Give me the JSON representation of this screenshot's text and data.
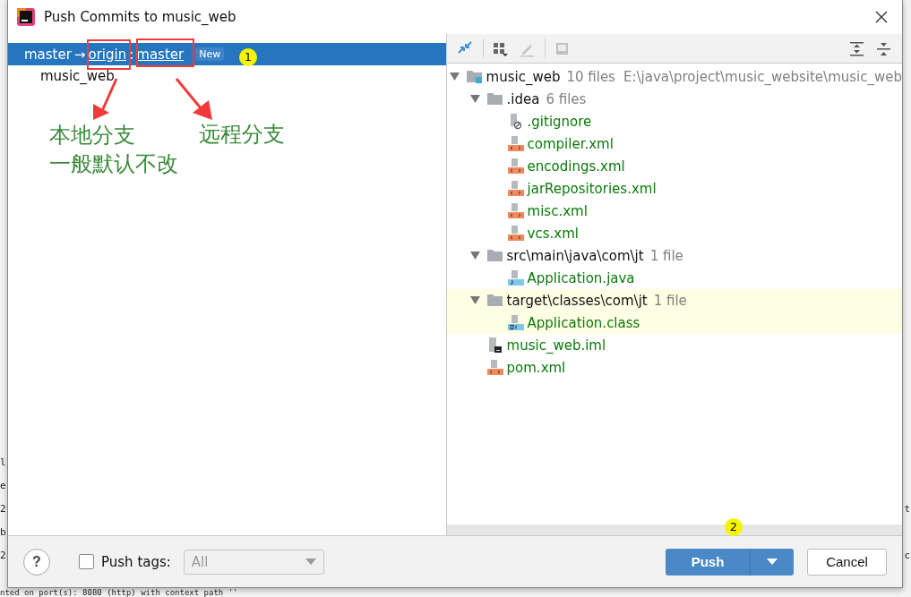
{
  "background": {
    "left_fragments": [
      "l",
      "e",
      "2",
      "b",
      "2"
    ],
    "right_fragments": [
      "t",
      "c"
    ],
    "log_line": "nted on port(s): 8080 (http) with context path ''"
  },
  "window": {
    "title": "Push Commits to music_web"
  },
  "push_spec": {
    "local_branch": "master",
    "arrow": "→",
    "remote": "origin",
    "separator": ":",
    "remote_branch": "master",
    "badge": "New",
    "selected": true
  },
  "repositories": [
    {
      "name": "music_web",
      "selected": false
    }
  ],
  "toolbar": [
    {
      "kind": "diff",
      "disabled": false
    },
    {
      "kind": "group",
      "disabled": false
    },
    {
      "kind": "edit",
      "disabled": true
    },
    {
      "kind": "preview",
      "disabled": true
    },
    {
      "kind": "expand",
      "disabled": false
    },
    {
      "kind": "collapse",
      "disabled": false
    }
  ],
  "tree": [
    {
      "name": "music_web",
      "kind": "module",
      "count": "10 files",
      "path": "E:\\java\\project\\music_website\\music_web",
      "expanded": true,
      "highlighted": false,
      "children": [
        {
          "name": ".idea",
          "kind": "folder",
          "count": "6 files",
          "expanded": true,
          "highlighted": false,
          "children": [
            {
              "name": ".gitignore",
              "kind": "ignored",
              "highlighted": false
            },
            {
              "name": "compiler.xml",
              "kind": "xml",
              "highlighted": false
            },
            {
              "name": "encodings.xml",
              "kind": "xml",
              "highlighted": false
            },
            {
              "name": "jarRepositories.xml",
              "kind": "xml",
              "highlighted": false
            },
            {
              "name": "misc.xml",
              "kind": "xml",
              "highlighted": false
            },
            {
              "name": "vcs.xml",
              "kind": "xml",
              "highlighted": false
            }
          ]
        },
        {
          "name": "src\\main\\java\\com\\jt",
          "kind": "folder",
          "count": "1 file",
          "expanded": true,
          "highlighted": false,
          "children": [
            {
              "name": "Application.java",
              "kind": "java",
              "highlighted": false
            }
          ]
        },
        {
          "name": "target\\classes\\com\\jt",
          "kind": "folder",
          "count": "1 file",
          "expanded": true,
          "highlighted": true,
          "children": [
            {
              "name": "Application.class",
              "kind": "class",
              "highlighted": true
            }
          ]
        },
        {
          "name": "music_web.iml",
          "kind": "iml",
          "highlighted": false
        },
        {
          "name": "pom.xml",
          "kind": "xml",
          "highlighted": false
        }
      ]
    }
  ],
  "footer": {
    "help": "?",
    "push_tags": {
      "label": "Push tags:",
      "checked": false
    },
    "tags_dropdown": {
      "value": "All",
      "disabled": true
    },
    "buttons": [
      {
        "label": "Push",
        "kind": "primary"
      },
      {
        "label": "Cancel",
        "kind": "secondary"
      }
    ]
  },
  "annotations": {
    "notes": [
      "本地分支",
      "一般默认不改",
      "远程分支"
    ],
    "markers": [
      "1",
      "2"
    ]
  }
}
